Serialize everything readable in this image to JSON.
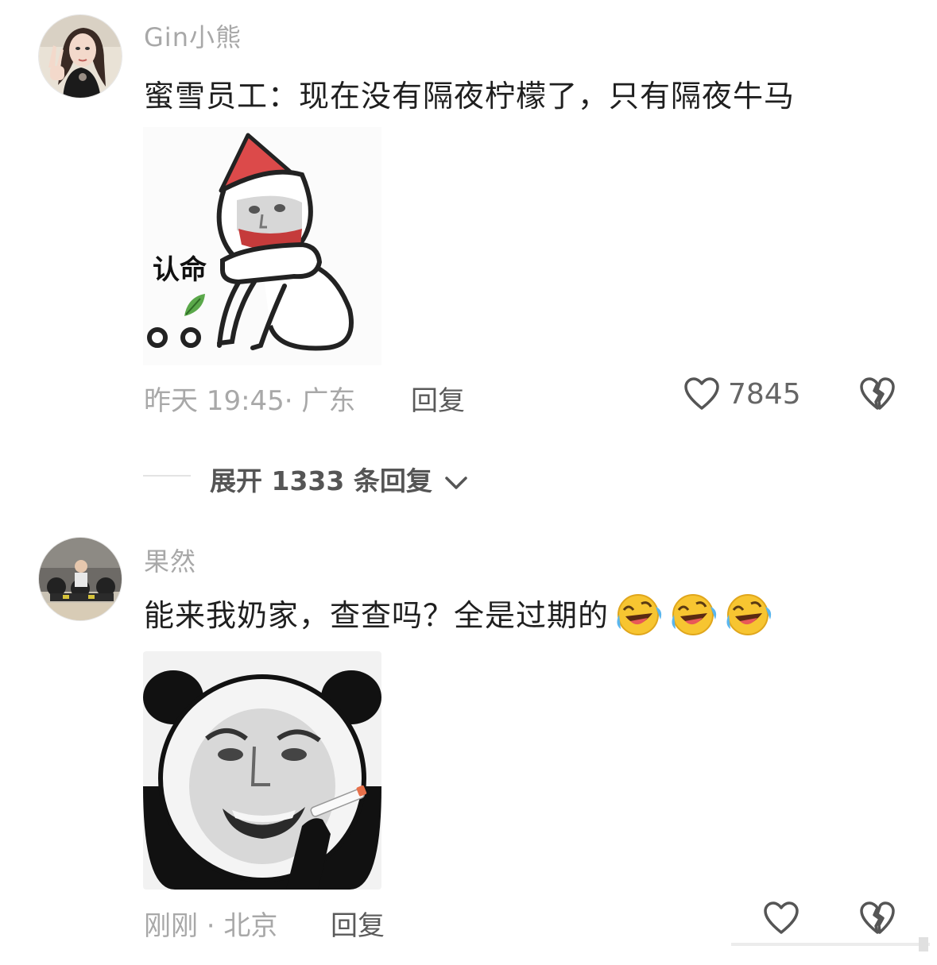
{
  "comments": [
    {
      "username": "Gin小熊",
      "text": "蜜雪员工：现在没有隔夜柠檬了，只有隔夜牛马",
      "sticker_caption": "认命",
      "meta": "昨天 19:45· 广东",
      "reply_label": "回复",
      "like_count": "7845"
    },
    {
      "username": "果然",
      "text": "能来我奶家，查查吗？全是过期的",
      "emoji": [
        "rolling-laughing",
        "rolling-laughing",
        "rolling-laughing"
      ],
      "meta": "刚刚 · 北京",
      "reply_label": "回复"
    }
  ],
  "expand_replies": "展开 1333 条回复",
  "icons": {
    "like": "heart-outline-icon",
    "dislike": "broken-heart-icon",
    "expand": "chevron-down-icon"
  },
  "colors": {
    "username": "#a8a8a8",
    "text": "#1f1f1f",
    "meta": "#a8a8a8",
    "reply": "#5a5a5a"
  }
}
